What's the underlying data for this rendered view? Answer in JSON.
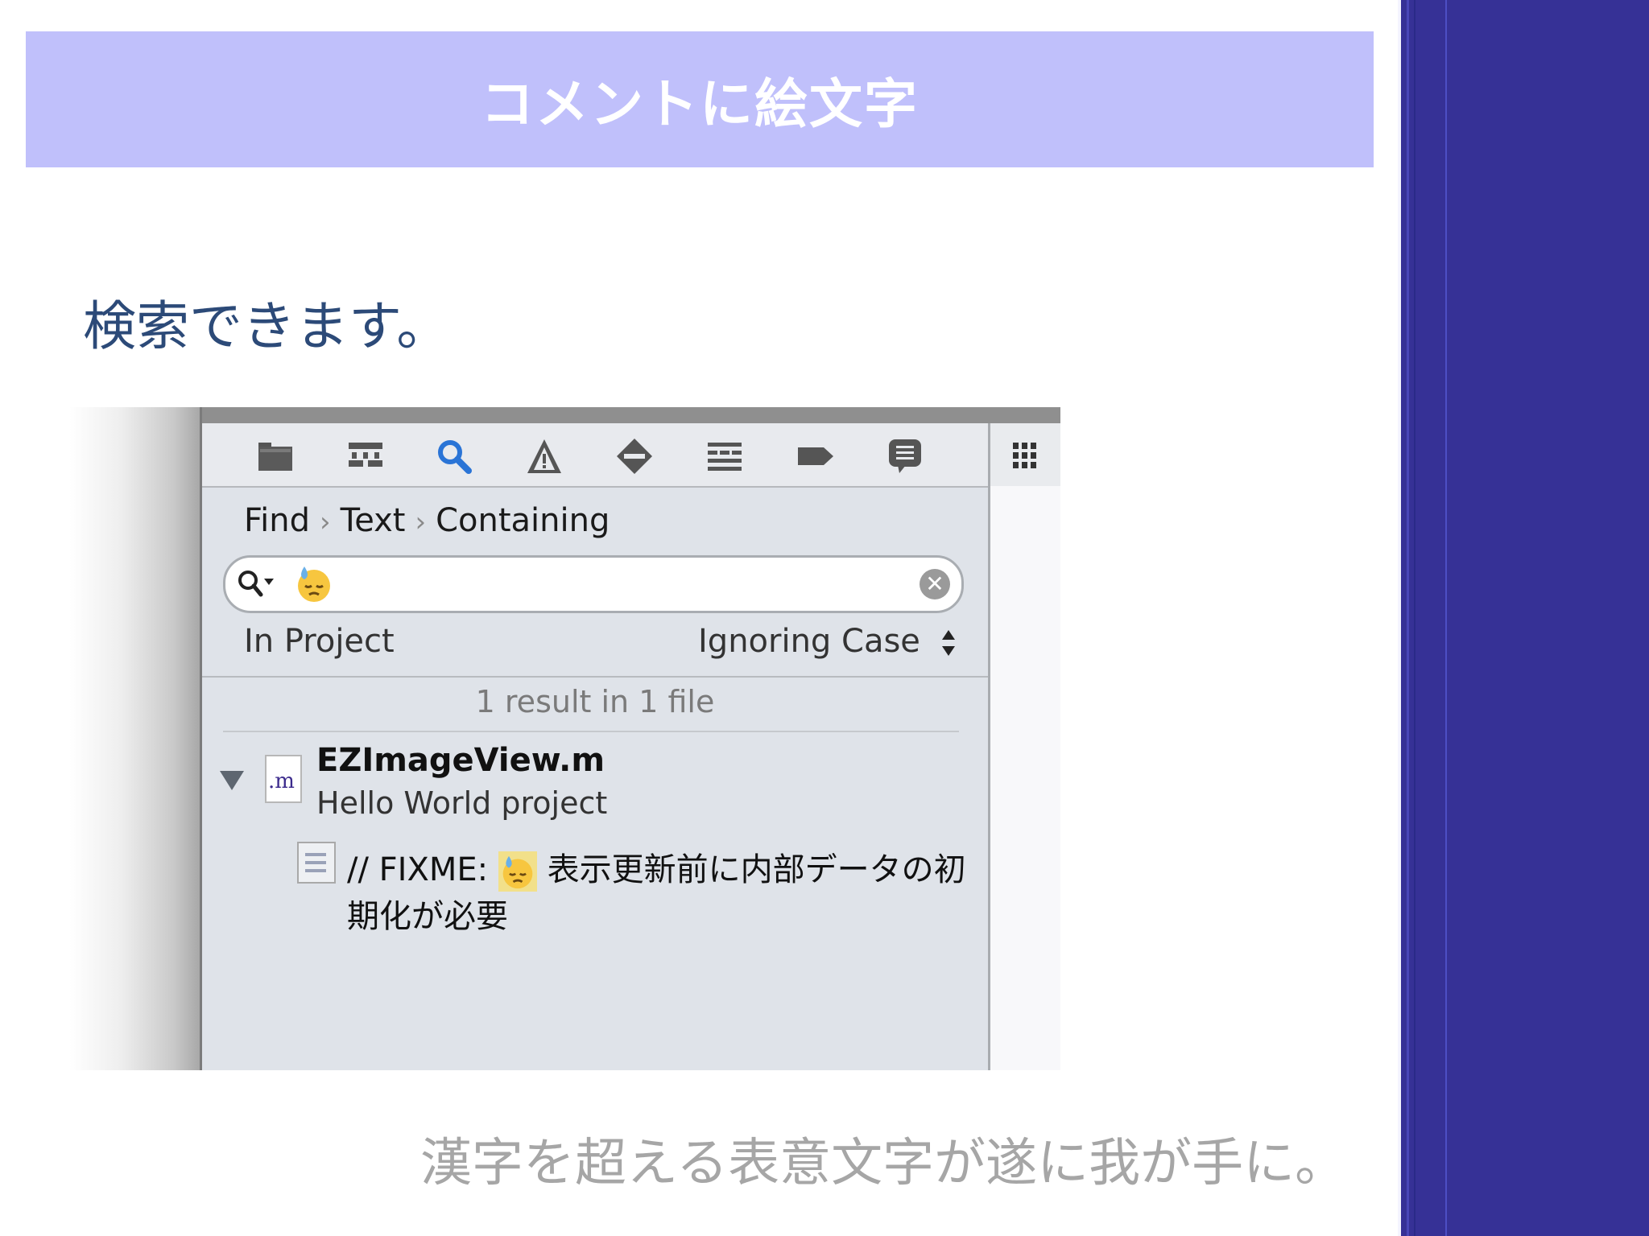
{
  "slide": {
    "title": "コメントに絵文字",
    "subtitle": "検索できます。",
    "caption": "漢字を超える表意文字が遂に我が手に。"
  },
  "colors": {
    "title_bar": "#c0c0fb",
    "sidebar": "#363196",
    "subtitle_text": "#2c4a78",
    "caption_text": "#a6a6a6"
  },
  "navigator": {
    "toolbar_icons": [
      "folder-icon",
      "hierarchy-icon",
      "search-icon",
      "warning-icon",
      "breakpoint-icon",
      "log-list-icon",
      "tag-icon",
      "chat-icon"
    ],
    "breadcrumb": [
      "Find",
      "Text",
      "Containing"
    ],
    "search": {
      "value": "😓"
    },
    "scope": "In Project",
    "case_mode": "Ignoring Case",
    "result_summary": "1 result in 1 file",
    "results": [
      {
        "file_name": "EZImageView.m",
        "file_ext": ".m",
        "project": "Hello World project",
        "match_prefix": "// FIXME:",
        "match_emoji": "😓",
        "match_suffix": "表示更新前に内部データの初期化が必要"
      }
    ]
  }
}
